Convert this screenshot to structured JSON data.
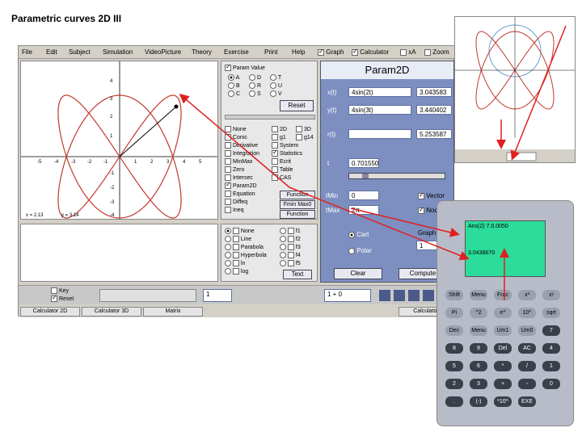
{
  "slide_title": "Parametric curves 2D  III",
  "menu": [
    "File",
    "Edit",
    "Subject",
    "Simulation",
    "VideoPicture",
    "Theory",
    "Exercise",
    "Print",
    "Help"
  ],
  "menu_checks": [
    {
      "label": "Graph",
      "on": true
    },
    {
      "label": "Calculator",
      "on": true
    },
    {
      "label": "xA",
      "on": false
    },
    {
      "label": "Zoom",
      "on": false
    }
  ],
  "axis_ticks_x": [
    "-5",
    "-4",
    "-3",
    "-2",
    "-1",
    "1",
    "2",
    "3",
    "4",
    "5"
  ],
  "axis_ticks_y": [
    "4",
    "3",
    "2",
    "1",
    "-1",
    "-2",
    "-3",
    "-4"
  ],
  "coord_x": "x = 2.13",
  "coord_y": "y = 3.14",
  "mid_top": {
    "header": "Param Value",
    "letters": [
      "A",
      "D",
      "T",
      "B",
      "R",
      "U",
      "C",
      "S",
      "V"
    ],
    "reset": "Reset"
  },
  "mid_list": [
    "None",
    "Conic",
    "Derivative",
    "Integration",
    "MinMax",
    "Zero",
    "Intersec",
    "Param2D",
    "Equation",
    "Diffeq",
    "Ineq"
  ],
  "mid_list2": [
    "2D",
    "3D",
    "g1",
    "g14",
    "System",
    "Statistics",
    "Ecrit",
    "Table",
    "CAS"
  ],
  "mid_btns": {
    "function": "Function",
    "fmin": "Fmin Max0",
    "fnction2": "Function"
  },
  "lower_list": [
    "None",
    "Line",
    "Parabola",
    "Hyperbola",
    "ln",
    "log"
  ],
  "lower_flist": [
    "f1",
    "f2",
    "f3",
    "f4",
    "f5"
  ],
  "lower_text_btn": "Text",
  "blue": {
    "title": "Param2D",
    "x_label": "x(t)",
    "x_expr": "4sin(2t)",
    "x_val": "3.043583",
    "y_label": "y(t)",
    "y_expr": "4sin(3t)",
    "y_val": "3.440402",
    "r_label": "r(t)",
    "r_val": "5.253587",
    "t_label": "t",
    "t_val": "0.701550",
    "tmin_label": "tMin",
    "tmin_val": "0",
    "tmax_label": "tMax",
    "tmax_val": "2π",
    "vector": "Vector",
    "nod": "Nod",
    "cart": "Cart",
    "polar": "Polar",
    "graph": "Graph",
    "graph_val": "1",
    "clear": "Clear",
    "compute": "Compute"
  },
  "bottom": {
    "key": "Key",
    "reset": "Reset",
    "step": "1",
    "formula": "1 + 0"
  },
  "tabs": [
    "Calculator 2D",
    "Calculator 3D",
    "Matrix",
    "Calculator"
  ],
  "calc_screen": {
    "line1": "Ans(2) 7.0.0050",
    "line2": "3.0438670"
  },
  "calc_keys": [
    "Shift",
    "Menu",
    "Frac",
    "x²",
    "xʸ",
    "Pi",
    "^2",
    "e^",
    "10^",
    "sqrt",
    "Dec",
    "Menu",
    "Um1",
    "Um0",
    "7",
    "8",
    "9",
    "Del",
    "AC",
    "4",
    "5",
    "6",
    "*",
    "/",
    "1",
    "2",
    "3",
    "+",
    "-",
    "0",
    ".",
    "(-)",
    "*10^",
    "EXE"
  ],
  "colors": {
    "curve": "#c0392b",
    "panel": "#7c8fc0",
    "screen": "#2bdc9a",
    "arrow": "#e02020"
  }
}
